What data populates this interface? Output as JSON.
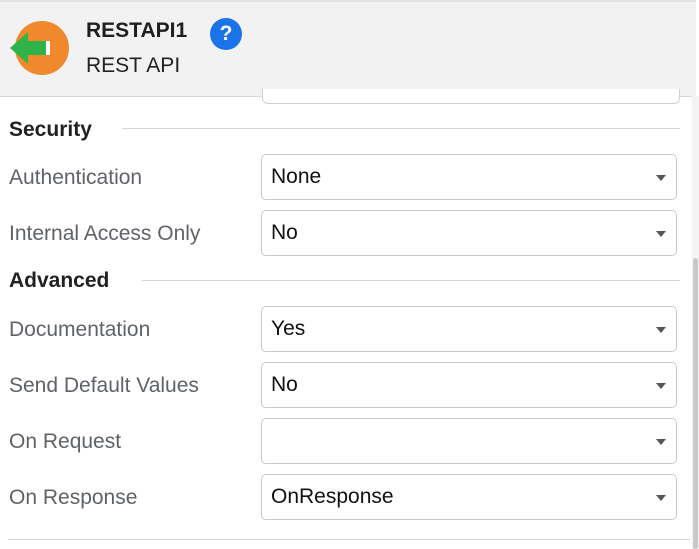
{
  "header": {
    "title": "RESTAPI1",
    "subtitle": "REST API",
    "help_icon": "?",
    "node_icon": "rest-api-arrow-icon",
    "colors": {
      "node_icon": "#f0892c",
      "arrow": "#2fb34a",
      "help": "#1a73e8"
    }
  },
  "sections": {
    "security": {
      "title": "Security",
      "fields": [
        {
          "label": "Authentication",
          "value": "None"
        },
        {
          "label": "Internal Access Only",
          "value": "No"
        }
      ]
    },
    "advanced": {
      "title": "Advanced",
      "fields": [
        {
          "label": "Documentation",
          "value": "Yes"
        },
        {
          "label": "Send Default Values",
          "value": "No"
        },
        {
          "label": "On Request",
          "value": ""
        },
        {
          "label": "On Response",
          "value": "OnResponse"
        }
      ]
    }
  }
}
